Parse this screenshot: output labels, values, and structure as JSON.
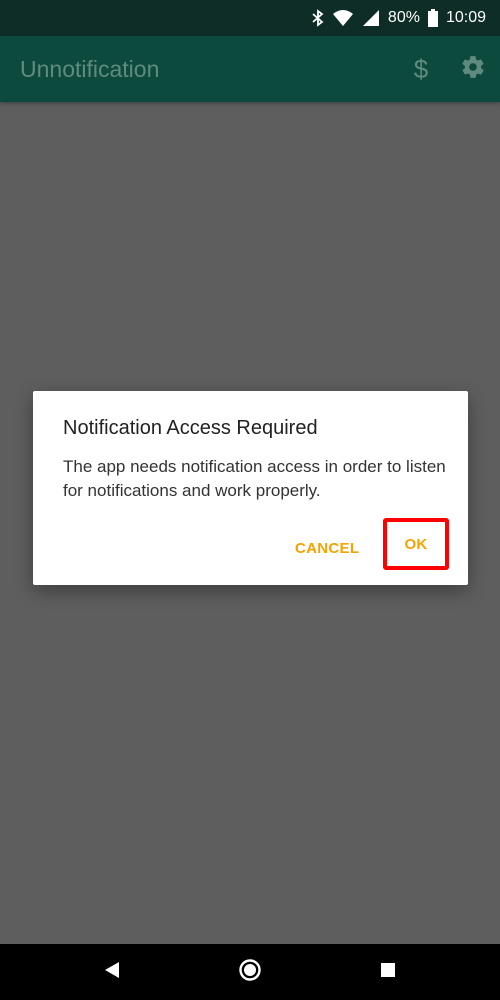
{
  "status_bar": {
    "battery_percent": "80%",
    "time": "10:09",
    "icons": [
      "bluetooth-icon",
      "wifi-icon",
      "signal-icon",
      "battery-icon"
    ]
  },
  "app_bar": {
    "title": "Unnotification",
    "actions": [
      "dollar-icon",
      "gear-icon"
    ]
  },
  "dialog": {
    "title": "Notification Access Required",
    "message": "The app needs notification access in order to listen for notifications and work properly.",
    "cancel_label": "CANCEL",
    "ok_label": "OK",
    "accent_color": "#f5a300",
    "highlight_color": "#ff0000"
  },
  "nav_bar": {
    "buttons": [
      "back-icon",
      "home-icon",
      "recents-icon"
    ]
  }
}
